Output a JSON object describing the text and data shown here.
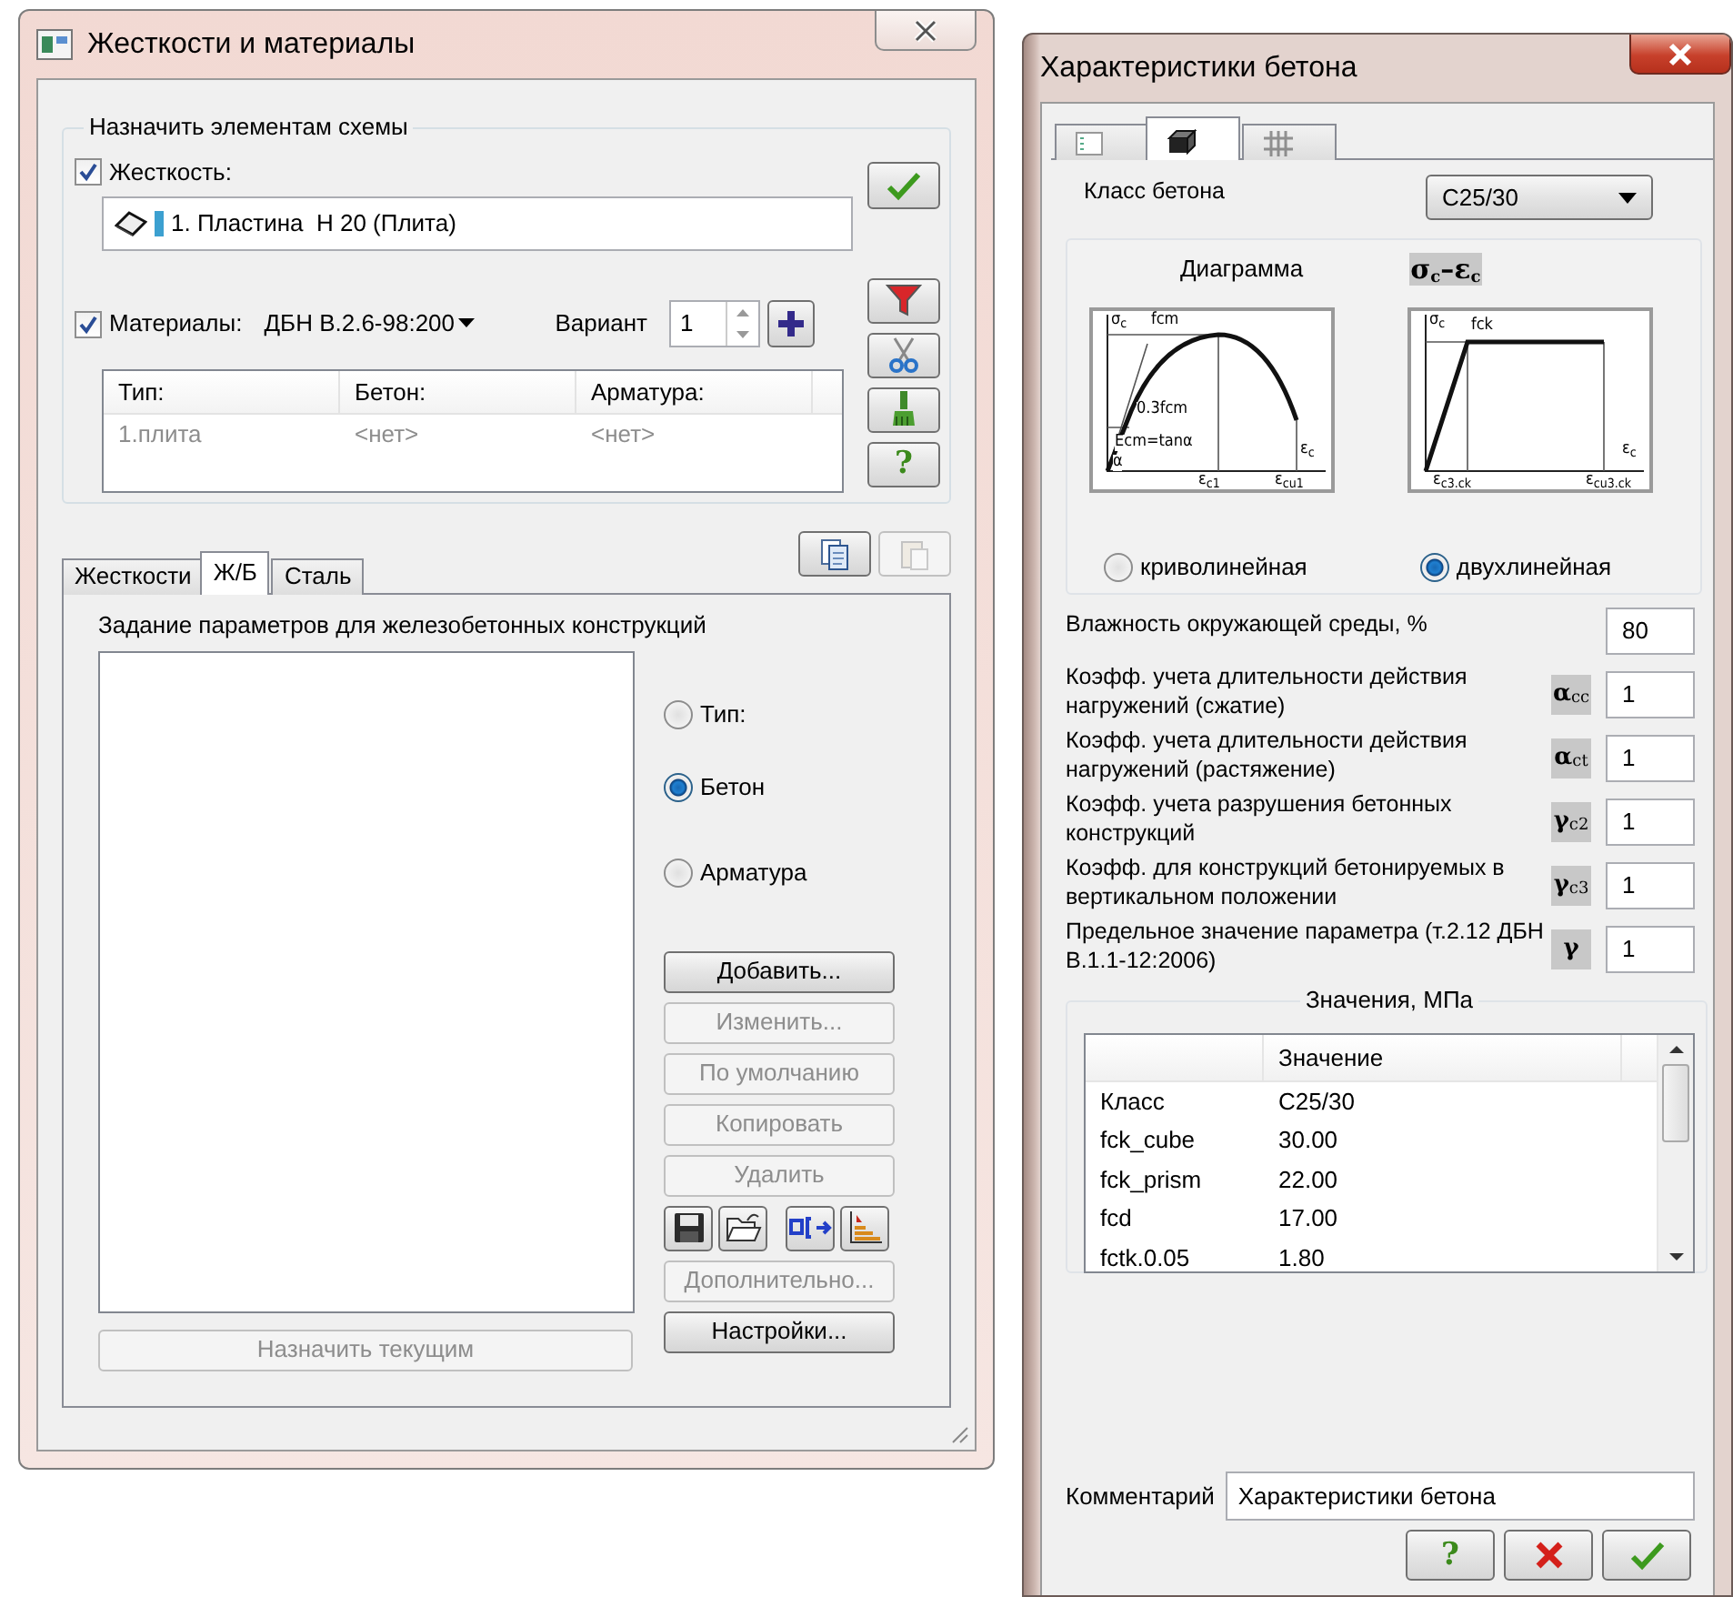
{
  "left_window": {
    "title": "Жесткости и материалы",
    "assign_group": {
      "title": "Назначить элементам схемы",
      "stiffness": {
        "label": "Жесткость:",
        "checked": true,
        "value": "1. Пластина  H 20 (Плита)"
      },
      "materials": {
        "label": "Материалы:",
        "checked": true,
        "norm": "ДБН В.2.6-98:200",
        "variant_label": "Вариант",
        "variant": "1"
      },
      "table": {
        "columns": [
          "Тип:",
          "Бетон:",
          "Арматура:"
        ],
        "rows": [
          [
            "1.плита",
            "<нет>",
            "<нет>"
          ]
        ]
      },
      "side_buttons": [
        {
          "kind": "filter"
        },
        {
          "kind": "scissors"
        },
        {
          "kind": "brush"
        },
        {
          "kind": "help",
          "label": "?"
        }
      ]
    },
    "tabs": [
      {
        "label": "Жесткости",
        "selected": false
      },
      {
        "label": "Ж/Б",
        "selected": true
      },
      {
        "label": "Сталь",
        "selected": false
      }
    ],
    "tool_buttons": [
      {
        "kind": "copy",
        "disabled": false
      },
      {
        "kind": "paste",
        "disabled": true
      }
    ],
    "panel": {
      "title": "Задание параметров для железобетонных конструкций",
      "radios": [
        {
          "label": "Тип:",
          "selected": false
        },
        {
          "label": "Бетон",
          "selected": true
        },
        {
          "label": "Арматура",
          "selected": false
        }
      ],
      "buttons": [
        {
          "label": "Добавить...",
          "disabled": false
        },
        {
          "label": "Изменить...",
          "disabled": true
        },
        {
          "label": "По умолчанию",
          "disabled": true
        },
        {
          "label": "Копировать",
          "disabled": true
        },
        {
          "label": "Удалить",
          "disabled": true
        }
      ],
      "icon_buttons": [
        {
          "kind": "save"
        },
        {
          "kind": "open"
        },
        {
          "kind": "dimension"
        },
        {
          "kind": "chart"
        }
      ],
      "more_buttons": [
        {
          "label": "Дополнительно...",
          "disabled": true
        },
        {
          "label": "Настройки...",
          "disabled": false
        }
      ],
      "assign_button": {
        "label": "Назначить текущим",
        "disabled": true
      }
    }
  },
  "right_window": {
    "title": "Характеристики бетона",
    "tabs": [
      {
        "kind": "list",
        "selected": false
      },
      {
        "kind": "block",
        "selected": true
      },
      {
        "kind": "rebar",
        "selected": false
      }
    ],
    "concrete_class": {
      "label": "Класс бетона",
      "value": "C25/30"
    },
    "diagram": {
      "title": "Диаграмма",
      "formula": "σ$_{c}$–ε$_{c}$",
      "plots": [
        {
          "kind": "curve",
          "labels": [
            "σ$_{c}$",
            "fcm",
            "0.3fcm",
            "Ecm=tanα",
            "α",
            "ε$_{c}$",
            "ε$_{c1}$",
            "ε$_{cu1}$"
          ]
        },
        {
          "kind": "bilinear",
          "labels": [
            "σ$_{c}$",
            "fck",
            "ε$_{c}$",
            "ε$_{c3.ck}$",
            "ε$_{cu3.ck}$"
          ]
        }
      ],
      "options": [
        {
          "label": "криволинейная",
          "selected": false
        },
        {
          "label": "двухлинейная",
          "selected": true
        }
      ]
    },
    "params": [
      {
        "label": "Влажность окружающей среды, %",
        "value": "80"
      },
      {
        "label": "Коэфф. учета длительности действия нагружений (сжатие)",
        "symbol": "α$_{cc}$",
        "value": "1"
      },
      {
        "label": "Коэфф. учета длительности действия нагружений (растяжение)",
        "symbol": "α$_{ct}$",
        "value": "1"
      },
      {
        "label": "Коэфф. учета разрушения бетонных конструкций",
        "symbol": "γ$_{c2}$",
        "value": "1"
      },
      {
        "label": "Коэфф. для конструкций бетонируемых в вертикальном положении",
        "symbol": "γ$_{c3}$",
        "value": "1"
      },
      {
        "label": "Предельное значение параметра (т.2.12 ДБН В.1.1-12:2006)",
        "symbol": "γ",
        "value": "1"
      }
    ],
    "values": {
      "title": "Значения, МПа",
      "column": "Значение",
      "rows": [
        [
          "Класс",
          "C25/30"
        ],
        [
          "fck_cube",
          "30.00"
        ],
        [
          "fck_prism",
          "22.00"
        ],
        [
          "fcd",
          "17.00"
        ],
        [
          "fctk.0.05",
          "1.80"
        ]
      ]
    },
    "comment": {
      "label": "Комментарий",
      "value": "Характеристики бетона"
    },
    "buttons": [
      {
        "kind": "help",
        "label": "?"
      },
      {
        "kind": "cancel"
      },
      {
        "kind": "ok"
      }
    ]
  }
}
